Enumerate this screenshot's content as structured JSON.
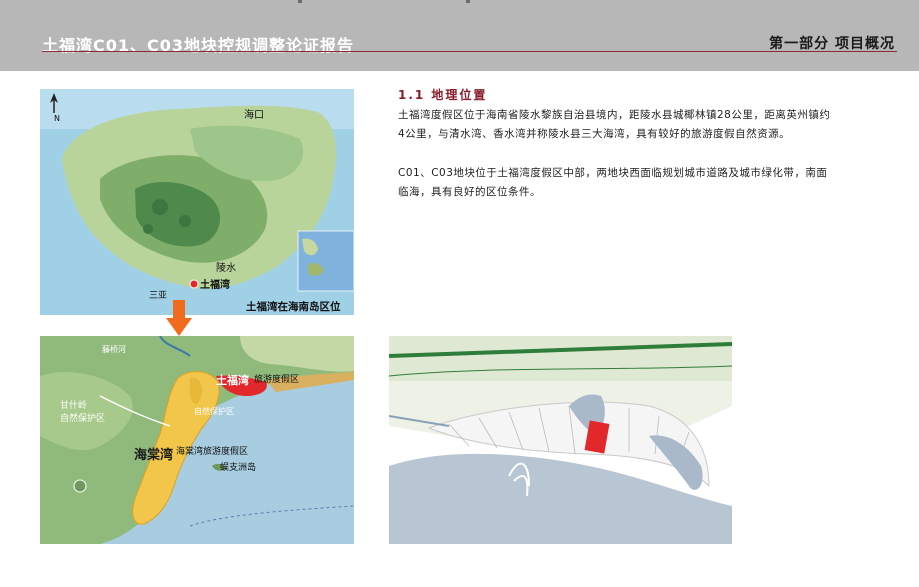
{
  "header": {
    "title": "土福湾C01、C03地块控规调整论证报告",
    "section": "第一部分  项目概况"
  },
  "section": {
    "heading": "1.1  地理位置",
    "paragraphs": [
      "土福湾度假区位于海南省陵水黎族自治县境内，距陵水县城椰林镇28公里，距离英州镇约4公里，与清水湾、香水湾并称陵水县三大海湾，具有较好的旅游度假自然资源。",
      "C01、C03地块位于土福湾度假区中部，两地块西面临规划城市道路及城市绿化带，南面临海，具有良好的区位条件。"
    ]
  },
  "map_island": {
    "north_label": "N",
    "haikou": "海口",
    "lingshui": "陵水",
    "tufuwan": "土福湾",
    "sanya": "三亚",
    "caption": "土福湾在海南岛区位"
  },
  "map_region": {
    "label_tufuwan": "土福湾",
    "label_resort": "旅游度假区",
    "label_ganshiling": "甘什岭\n自然保护区",
    "label_reserve": "自然保护区",
    "label_haitang": "海棠湾",
    "label_haitang_resort": "海棠湾旅游度假区",
    "label_island": "蜈支洲岛",
    "label_river": "藤桥河"
  },
  "colors": {
    "header_bg": "#b7b7b7",
    "accent": "#8a1c2c",
    "highlight_red": "#e3282b",
    "arrow": "#f26a1b"
  }
}
